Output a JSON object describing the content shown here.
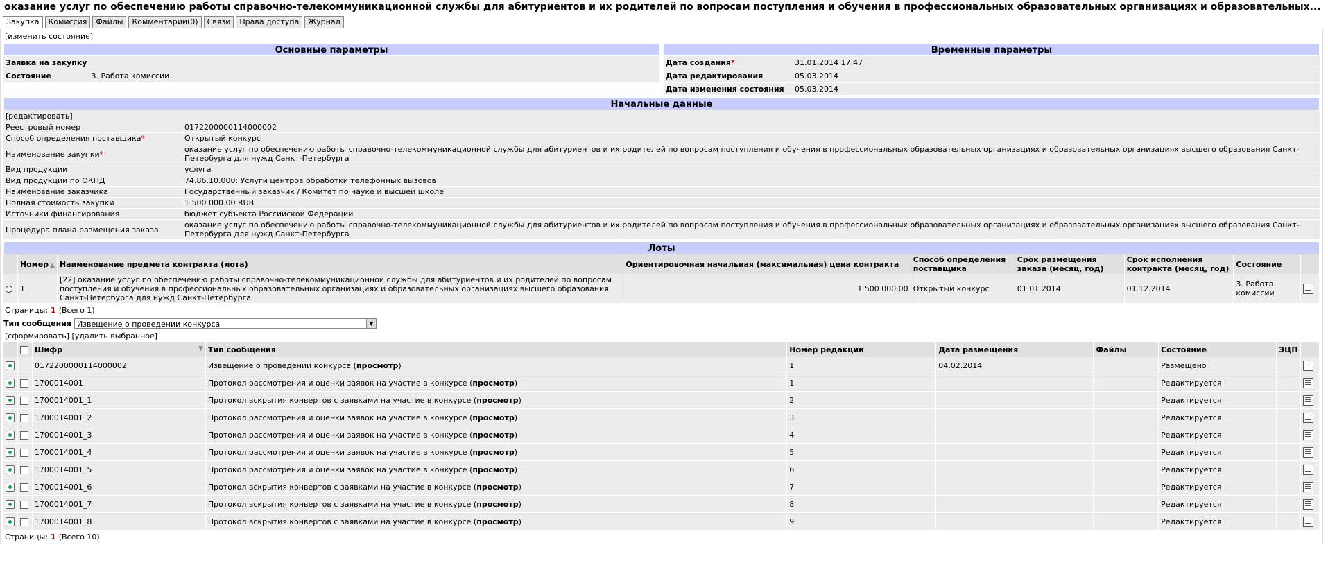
{
  "title": "оказание услуг по обеспечению работы справочно-телекоммуникационной службы для абитуриентов и их родителей по вопросам поступления и обучения в профессиональных образовательных организациях и образовательных...",
  "tabs": [
    "Закупка",
    "Комиссия",
    "Файлы",
    "Комментарии(0)",
    "Связи",
    "Права доступа",
    "Журнал"
  ],
  "change_state": "[изменить состояние]",
  "basic": {
    "heading": "Основные параметры",
    "rows": [
      {
        "label": "Заявка на закупку",
        "value": ""
      },
      {
        "label": "Состояние",
        "value": "3. Работа комиссии"
      }
    ]
  },
  "timing": {
    "heading": "Временные параметры",
    "rows": [
      {
        "label": "Дата создания",
        "req": "*",
        "value": "31.01.2014 17:47"
      },
      {
        "label": "Дата редактирования",
        "req": "",
        "value": "05.03.2014"
      },
      {
        "label": "Дата изменения состояния",
        "req": "",
        "value": "05.03.2014"
      }
    ]
  },
  "initial": {
    "heading": "Начальные данные",
    "edit": "[редактировать]",
    "rows": [
      {
        "label": "Реестровый номер",
        "req": "",
        "value": "0172200000114000002"
      },
      {
        "label": "Способ определения поставщика",
        "req": "*",
        "value": "Открытый конкурс"
      },
      {
        "label": "Наименование закупки",
        "req": "*",
        "value": "оказание услуг по обеспечению работы справочно-телекоммуникационной службы для абитуриентов и их родителей по вопросам поступления и обучения в профессиональных образовательных организациях и образовательных организациях высшего образования Санкт-Петербурга для нужд Санкт-Петербурга"
      },
      {
        "label": "Вид продукции",
        "req": "",
        "value": "услуга"
      },
      {
        "label": "Вид продукции по ОКПД",
        "req": "",
        "value": "74.86.10.000: Услуги центров обработки телефонных вызовов"
      },
      {
        "label": "Наименование заказчика",
        "req": "",
        "value": "Государственный заказчик / Комитет по науке и высшей школе"
      },
      {
        "label": "Полная стоимость закупки",
        "req": "",
        "value": "1 500 000.00 RUB"
      },
      {
        "label": "Источники финансирования",
        "req": "",
        "value": "бюджет субъекта Российской Федерации"
      },
      {
        "label": "Процедура плана размещения заказа",
        "req": "",
        "value": "оказание услуг по обеспечению работы справочно-телекоммуникационной службы для абитуриентов и их родителей по вопросам поступления и обучения в профессиональных образовательных организациях и образовательных организациях высшего образования Санкт-Петербурга для нужд Санкт-Петербурга"
      }
    ]
  },
  "lots": {
    "heading": "Лоты",
    "columns": [
      "Номер",
      "Наименование предмета контракта (лота)",
      "Ориентировочная начальная (максимальная) цена контракта",
      "Способ определения поставщика",
      "Срок размещения заказа (месяц, год)",
      "Срок исполнения контракта (месяц, год)",
      "Состояние"
    ],
    "rows": [
      {
        "num": "1",
        "name": "[22] оказание услуг по обеспечению работы справочно-телекоммуникационной службы для абитуриентов и их родителей по вопросам поступления и обучения в профессиональных образовательных организациях и образовательных организациях высшего образования Санкт-Петербурга для нужд Санкт-Петербурга",
        "price": "1 500 000.00",
        "method": "Открытый конкурс",
        "placement": "01.01.2014",
        "execution": "01.12.2014",
        "state": "3. Работа комиссии"
      }
    ],
    "pager": {
      "label": "Страницы:",
      "current": "1",
      "total": "(Всего 1)"
    }
  },
  "messages": {
    "type_label": "Тип сообщения",
    "type_value": "Извещение о проведении конкурса",
    "generate": "[сформировать]",
    "delete_selected": "[удалить выбранное]",
    "columns": [
      "Шифр",
      "Тип сообщения",
      "Номер редакции",
      "Дата размещения",
      "Файлы",
      "Состояние",
      "ЭЦП"
    ],
    "view_label": "просмотр",
    "rows": [
      {
        "code": "0172200000114000002",
        "type": "Извещение о проведении конкурса",
        "rev": "1",
        "date": "04.02.2014",
        "files": "",
        "state": "Размещено",
        "checkbox": false
      },
      {
        "code": "1700014001",
        "type": "Протокол рассмотрения и оценки заявок на участие в конкурсе",
        "rev": "1",
        "date": "",
        "files": "",
        "state": "Редактируется",
        "checkbox": true
      },
      {
        "code": "1700014001_1",
        "type": "Протокол вскрытия конвертов с заявками на участие в конкурсе",
        "rev": "2",
        "date": "",
        "files": "",
        "state": "Редактируется",
        "checkbox": true
      },
      {
        "code": "1700014001_2",
        "type": "Протокол рассмотрения и оценки заявок на участие в конкурсе",
        "rev": "3",
        "date": "",
        "files": "",
        "state": "Редактируется",
        "checkbox": true
      },
      {
        "code": "1700014001_3",
        "type": "Протокол рассмотрения и оценки заявок на участие в конкурсе",
        "rev": "4",
        "date": "",
        "files": "",
        "state": "Редактируется",
        "checkbox": true
      },
      {
        "code": "1700014001_4",
        "type": "Протокол рассмотрения и оценки заявок на участие в конкурсе",
        "rev": "5",
        "date": "",
        "files": "",
        "state": "Редактируется",
        "checkbox": true
      },
      {
        "code": "1700014001_5",
        "type": "Протокол рассмотрения и оценки заявок на участие в конкурсе",
        "rev": "6",
        "date": "",
        "files": "",
        "state": "Редактируется",
        "checkbox": true
      },
      {
        "code": "1700014001_6",
        "type": "Протокол вскрытия конвертов с заявками на участие в конкурсе",
        "rev": "7",
        "date": "",
        "files": "",
        "state": "Редактируется",
        "checkbox": true
      },
      {
        "code": "1700014001_7",
        "type": "Протокол вскрытия конвертов с заявками на участие в конкурсе",
        "rev": "8",
        "date": "",
        "files": "",
        "state": "Редактируется",
        "checkbox": true
      },
      {
        "code": "1700014001_8",
        "type": "Протокол вскрытия конвертов с заявками на участие в конкурсе",
        "rev": "9",
        "date": "",
        "files": "",
        "state": "Редактируется",
        "checkbox": true
      }
    ],
    "pager": {
      "label": "Страницы:",
      "current": "1",
      "total": "(Всего 10)"
    }
  }
}
